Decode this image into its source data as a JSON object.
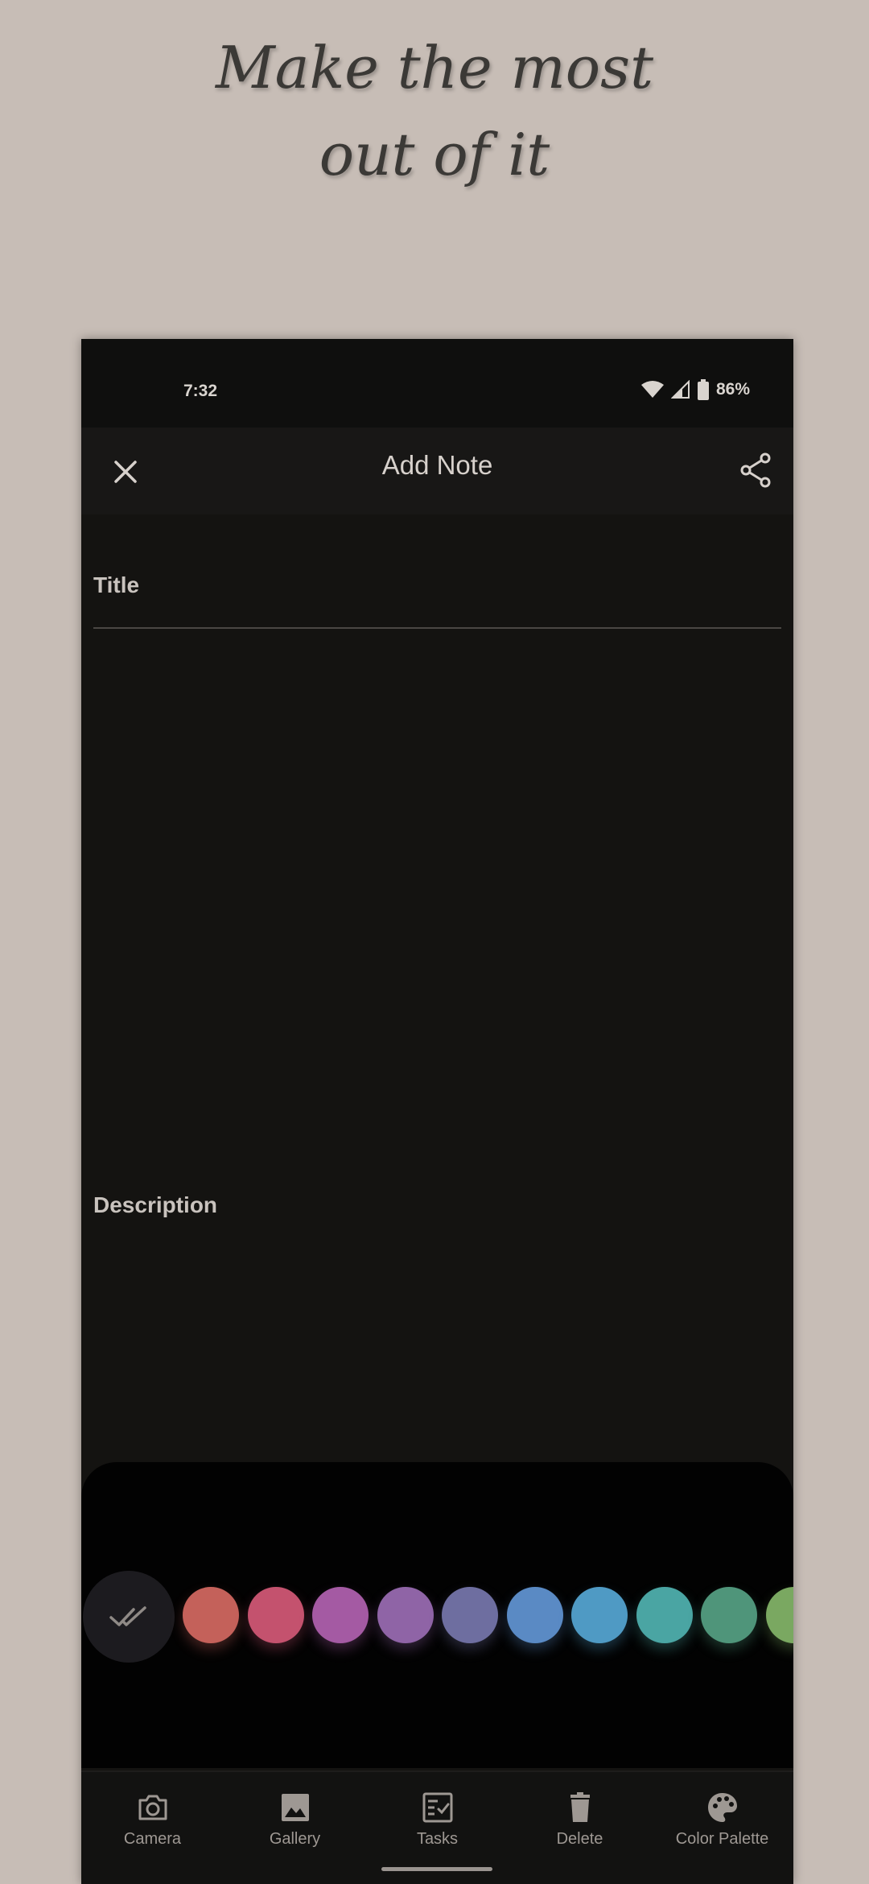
{
  "promo": {
    "line1": "Make the most",
    "line2": "out of it"
  },
  "status_bar": {
    "time": "7:32",
    "battery": "86%",
    "icons": [
      "wifi-icon",
      "signal-icon",
      "battery-icon"
    ]
  },
  "app_bar": {
    "title": "Add Note",
    "close_icon": "close-icon",
    "share_icon": "share-icon"
  },
  "form": {
    "title_placeholder": "Title",
    "description_placeholder": "Description"
  },
  "palette": {
    "confirm_icon": "double-check-icon",
    "swatches": [
      "#c4615a",
      "#c4526e",
      "#a45aa3",
      "#8f64a6",
      "#6e6ea0",
      "#5a8ac4",
      "#4f9ac4",
      "#4aa5a3",
      "#4f957a",
      "#7aa861"
    ]
  },
  "bottom_nav": {
    "items": [
      {
        "label": "Camera",
        "icon": "camera-icon"
      },
      {
        "label": "Gallery",
        "icon": "gallery-icon"
      },
      {
        "label": "Tasks",
        "icon": "tasks-icon"
      },
      {
        "label": "Delete",
        "icon": "delete-icon"
      },
      {
        "label": "Color Palette",
        "icon": "palette-icon"
      }
    ]
  },
  "colors": {
    "background": "#c7bdb6",
    "phone_bg": "#141311",
    "text": "#d7d1cc"
  }
}
